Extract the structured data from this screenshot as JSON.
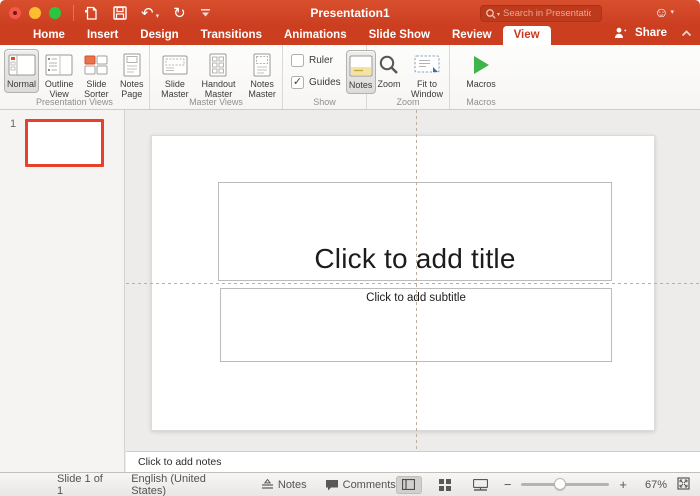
{
  "colors": {
    "accent_red": "#cb3f20",
    "active_tab_text": "#c8391d",
    "thumbnail_selected_border": "#e8402a",
    "macros_green": "#3eb44a",
    "notes_icon_yellow": "#f3e3a5"
  },
  "window": {
    "title": "Presentation1"
  },
  "titlebar": {
    "search_placeholder": "Search in Presentation"
  },
  "tabs": [
    {
      "label": "Home",
      "active": false
    },
    {
      "label": "Insert",
      "active": false
    },
    {
      "label": "Design",
      "active": false
    },
    {
      "label": "Transitions",
      "active": false
    },
    {
      "label": "Animations",
      "active": false
    },
    {
      "label": "Slide Show",
      "active": false
    },
    {
      "label": "Review",
      "active": false
    },
    {
      "label": "View",
      "active": true
    }
  ],
  "share": {
    "label": "Share"
  },
  "ribbon": {
    "presentation_views": {
      "group_label": "Presentation Views",
      "buttons": [
        {
          "label": "Normal",
          "selected": true
        },
        {
          "label": "Outline View",
          "selected": false
        },
        {
          "label": "Slide Sorter",
          "selected": false
        },
        {
          "label": "Notes Page",
          "selected": false
        }
      ]
    },
    "master_views": {
      "group_label": "Master Views",
      "buttons": [
        {
          "label": "Slide Master"
        },
        {
          "label": "Handout Master"
        },
        {
          "label": "Notes Master"
        }
      ]
    },
    "show": {
      "group_label": "Show",
      "ruler_label": "Ruler",
      "ruler_checked": false,
      "guides_label": "Guides",
      "guides_checked": true,
      "guides_check_glyph": "✓",
      "notes_label": "Notes",
      "notes_selected": true
    },
    "zoom": {
      "group_label": "Zoom",
      "zoom_label": "Zoom",
      "fit_label": "Fit to Window"
    },
    "macros": {
      "group_label": "Macros",
      "macros_label": "Macros"
    }
  },
  "thumbnail_panel": {
    "slide_number": "1"
  },
  "slide": {
    "title_placeholder": "Click to add title",
    "subtitle_placeholder": "Click to add subtitle"
  },
  "notes_pane": {
    "placeholder": "Click to add notes"
  },
  "statusbar": {
    "slide_counter": "Slide 1 of 1",
    "language": "English (United States)",
    "notes_label": "Notes",
    "comments_label": "Comments",
    "zoom_percent": "67%"
  }
}
